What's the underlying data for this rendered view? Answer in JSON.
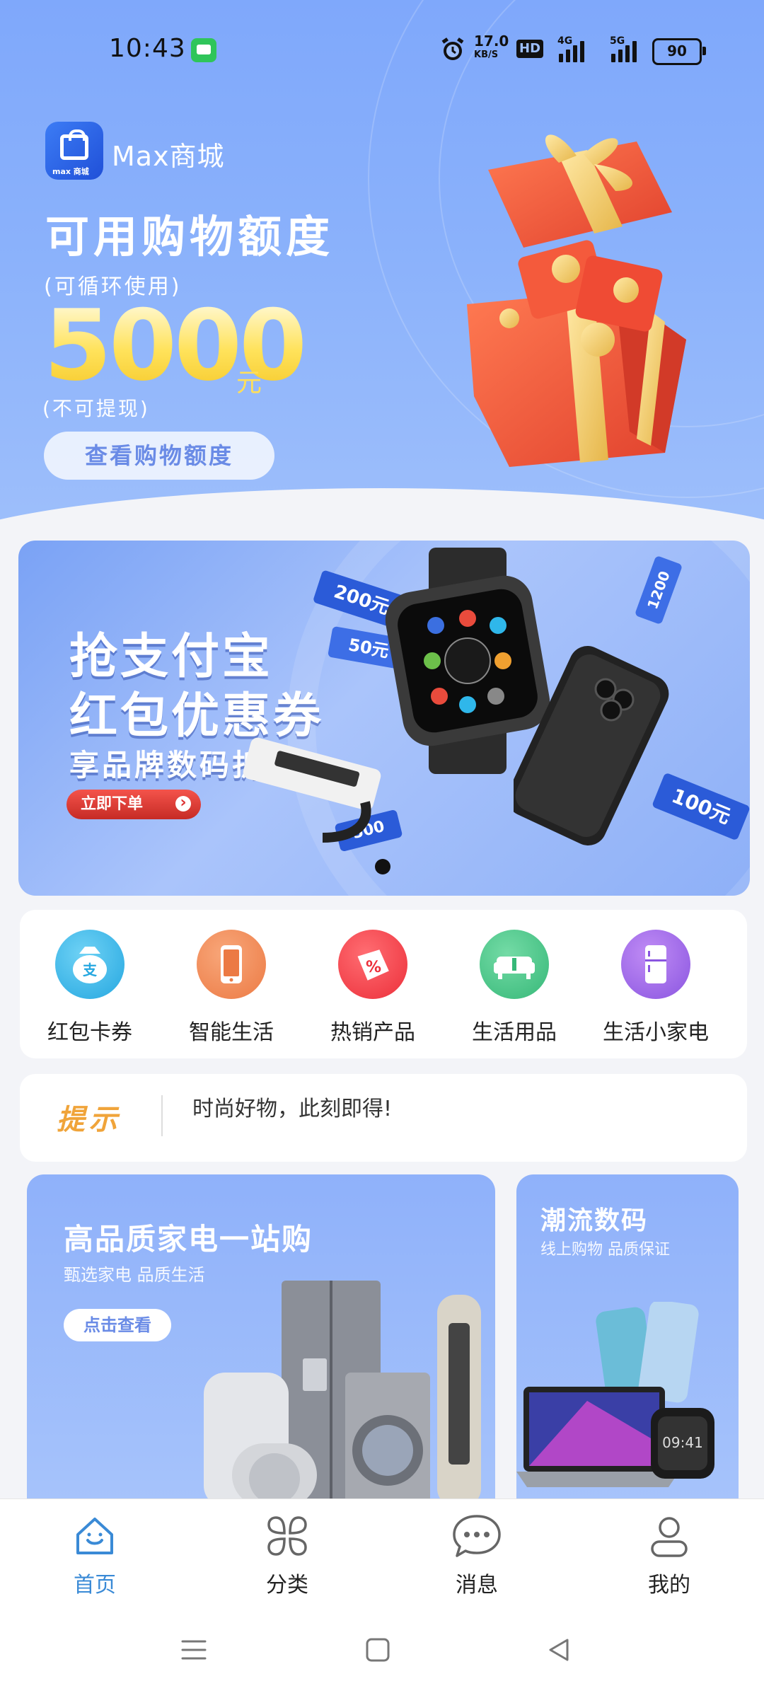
{
  "status_bar": {
    "time": "10:43",
    "speed_value": "17.0",
    "speed_unit": "KB/S",
    "hd_badge": "HD",
    "net_4g": "4G",
    "net_5g": "5G",
    "battery": "90"
  },
  "header": {
    "brand": "Max商城",
    "title": "可用购物额度",
    "subtitle": "(可循环使用)",
    "amount": "5000",
    "unit": "元",
    "note": "(不可提现)",
    "button": "查看购物额度",
    "logo_text": "max 商城"
  },
  "banner": {
    "line1": "抢支付宝",
    "line2": "红包优惠券",
    "line3": "享品牌数码折扣",
    "cta": "立即下单",
    "coupons": [
      "200元",
      "50元",
      "100元",
      "500",
      "1200"
    ]
  },
  "categories": [
    {
      "label": "红包卡券",
      "icon": "money-bag-icon",
      "color": "#3fb5e8"
    },
    {
      "label": "智能生活",
      "icon": "smartphone-icon",
      "color": "#f08a55"
    },
    {
      "label": "热销产品",
      "icon": "discount-tag-icon",
      "color": "#f0444c"
    },
    {
      "label": "生活用品",
      "icon": "sofa-icon",
      "color": "#45c386"
    },
    {
      "label": "生活小家电",
      "icon": "fridge-icon",
      "color": "#9a67e6"
    }
  ],
  "tip": {
    "label": "提示",
    "message": "时尚好物，此刻即得!"
  },
  "promos": [
    {
      "title": "高品质家电一站购",
      "subtitle": "甄选家电 品质生活",
      "button": "点击查看"
    },
    {
      "title": "潮流数码",
      "subtitle": "线上购物 品质保证"
    }
  ],
  "tabbar": [
    {
      "label": "首页",
      "icon": "home-icon",
      "active": true
    },
    {
      "label": "分类",
      "icon": "category-grid-icon",
      "active": false
    },
    {
      "label": "消息",
      "icon": "message-bubble-icon",
      "active": false
    },
    {
      "label": "我的",
      "icon": "user-icon",
      "active": false
    }
  ],
  "colors": {
    "header_blue": "#8ab1fb",
    "amount_gold": "#ffe25a",
    "tab_active": "#3a8ad6",
    "tip_orange": "#f0a43a"
  }
}
